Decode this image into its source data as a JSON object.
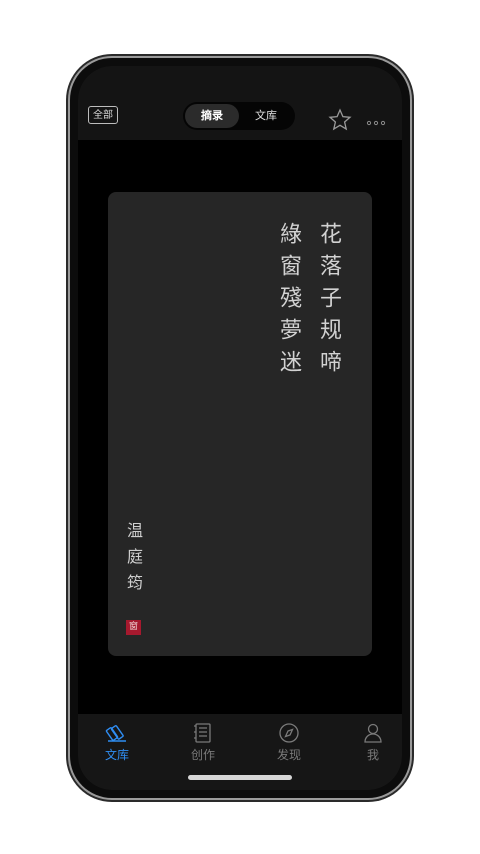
{
  "header": {
    "all_button": "全部",
    "tabs": [
      {
        "label": "摘录",
        "active": true
      },
      {
        "label": "文库",
        "active": false
      }
    ],
    "star_icon": "star-outline-icon",
    "more_icon": "more-dots-icon"
  },
  "card": {
    "poem_lines": [
      "花落子规啼",
      "綠窗殘夢迷"
    ],
    "author": "温庭筠",
    "seal": "窗"
  },
  "bottom_nav": [
    {
      "label": "文库",
      "icon": "books-icon",
      "active": true
    },
    {
      "label": "创作",
      "icon": "notebook-icon",
      "active": false
    },
    {
      "label": "发现",
      "icon": "compass-icon",
      "active": false
    },
    {
      "label": "我",
      "icon": "person-icon",
      "active": false
    }
  ],
  "colors": {
    "accent": "#2f8df2",
    "seal": "#a6192e"
  }
}
